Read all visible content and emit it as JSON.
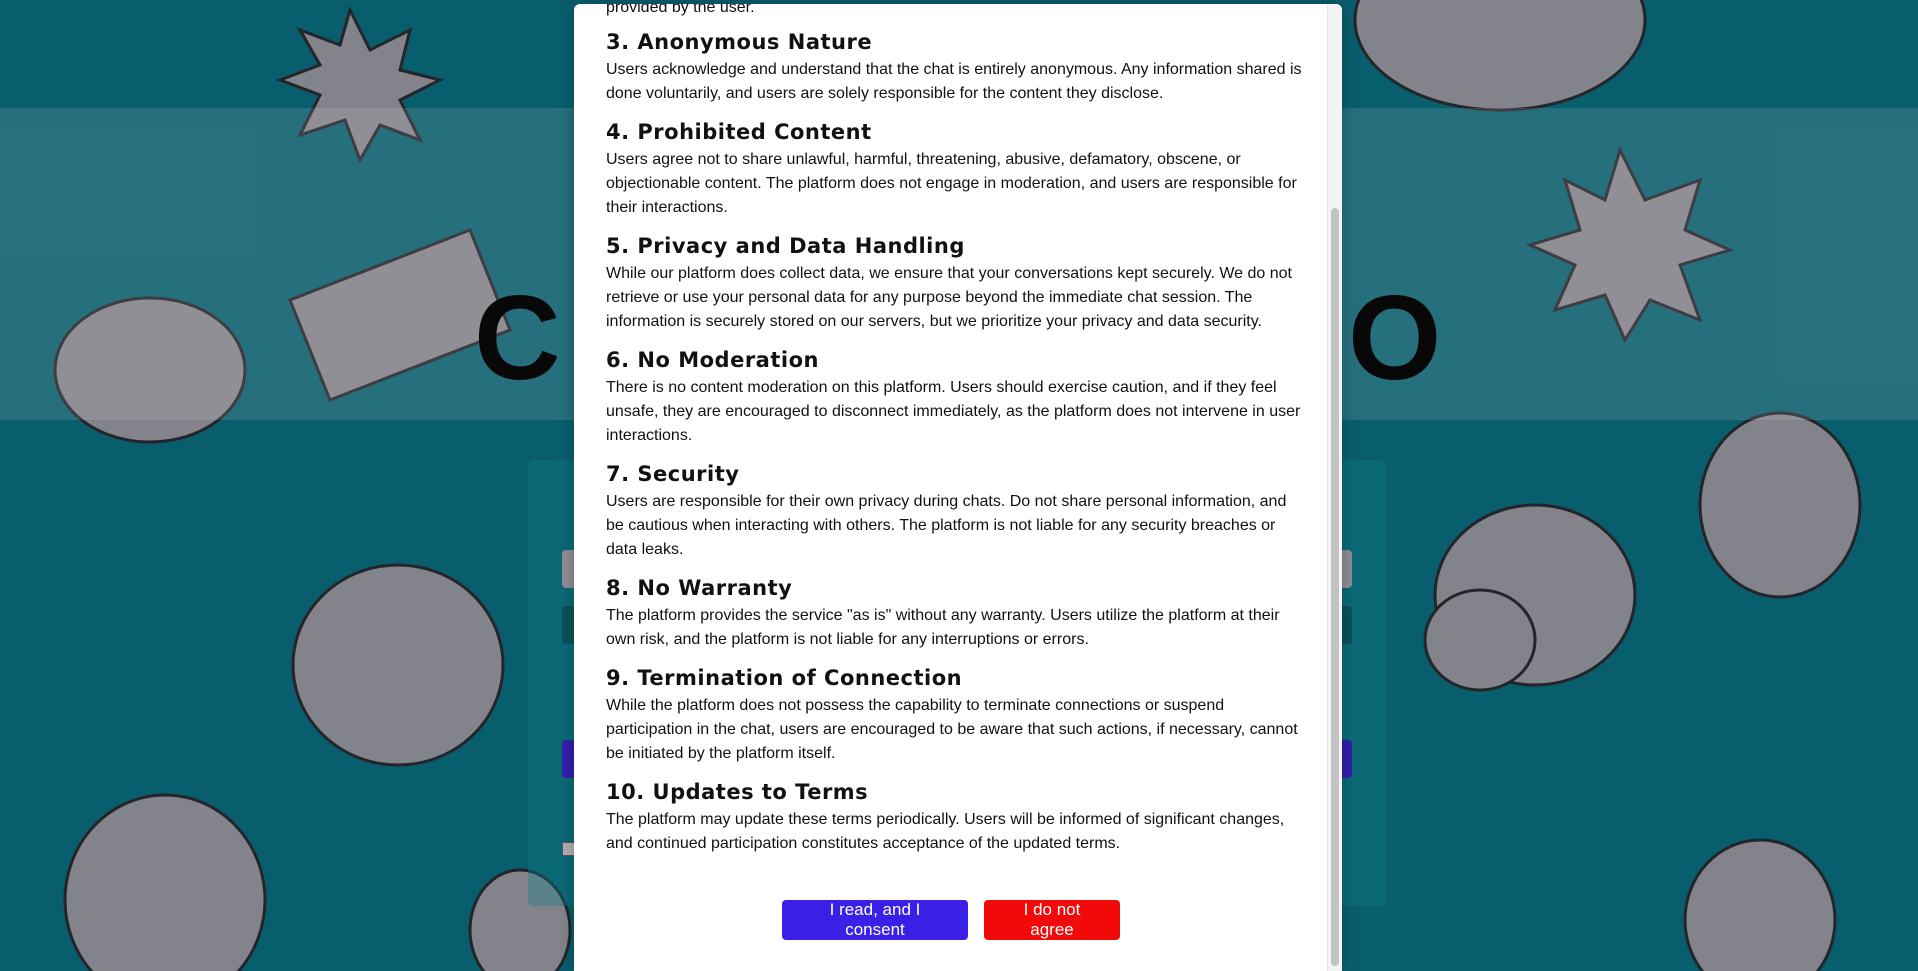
{
  "background": {
    "logo_left_letter": "C",
    "logo_right_letter": "O",
    "colors": {
      "teal": "#0b6f80",
      "bubble": "#9a9aa4"
    }
  },
  "modal": {
    "intro_tail": "provided by the user.",
    "sections": [
      {
        "heading": "3. Anonymous Nature",
        "body": "Users acknowledge and understand that the chat is entirely anonymous. Any information shared is done voluntarily, and users are solely responsible for the content they disclose."
      },
      {
        "heading": "4. Prohibited Content",
        "body": "Users agree not to share unlawful, harmful, threatening, abusive, defamatory, obscene, or objectionable content. The platform does not engage in moderation, and users are responsible for their interactions."
      },
      {
        "heading": "5. Privacy and Data Handling",
        "body": "While our platform does collect data, we ensure that your conversations kept securely. We do not retrieve or use your personal data for any purpose beyond the immediate chat session. The information is securely stored on our servers, but we prioritize your privacy and data security."
      },
      {
        "heading": "6. No Moderation",
        "body": "There is no content moderation on this platform. Users should exercise caution, and if they feel unsafe, they are encouraged to disconnect immediately, as the platform does not intervene in user interactions."
      },
      {
        "heading": "7. Security",
        "body": "Users are responsible for their own privacy during chats. Do not share personal information, and be cautious when interacting with others. The platform is not liable for any security breaches or data leaks."
      },
      {
        "heading": "8. No Warranty",
        "body": "The platform provides the service \"as is\" without any warranty. Users utilize the platform at their own risk, and the platform is not liable for any interruptions or errors."
      },
      {
        "heading": "9. Termination of Connection",
        "body": "While the platform does not possess the capability to terminate connections or suspend participation in the chat, users are encouraged to be aware that such actions, if necessary, cannot be initiated by the platform itself."
      },
      {
        "heading": "10. Updates to Terms",
        "body": "The platform may update these terms periodically. Users will be informed of significant changes, and continued participation constitutes acceptance of the updated terms."
      }
    ],
    "consent_label": "I read, and I consent",
    "decline_label": "I do not agree",
    "colors": {
      "consent": "#3a1fe6",
      "decline": "#f20a0a"
    }
  }
}
